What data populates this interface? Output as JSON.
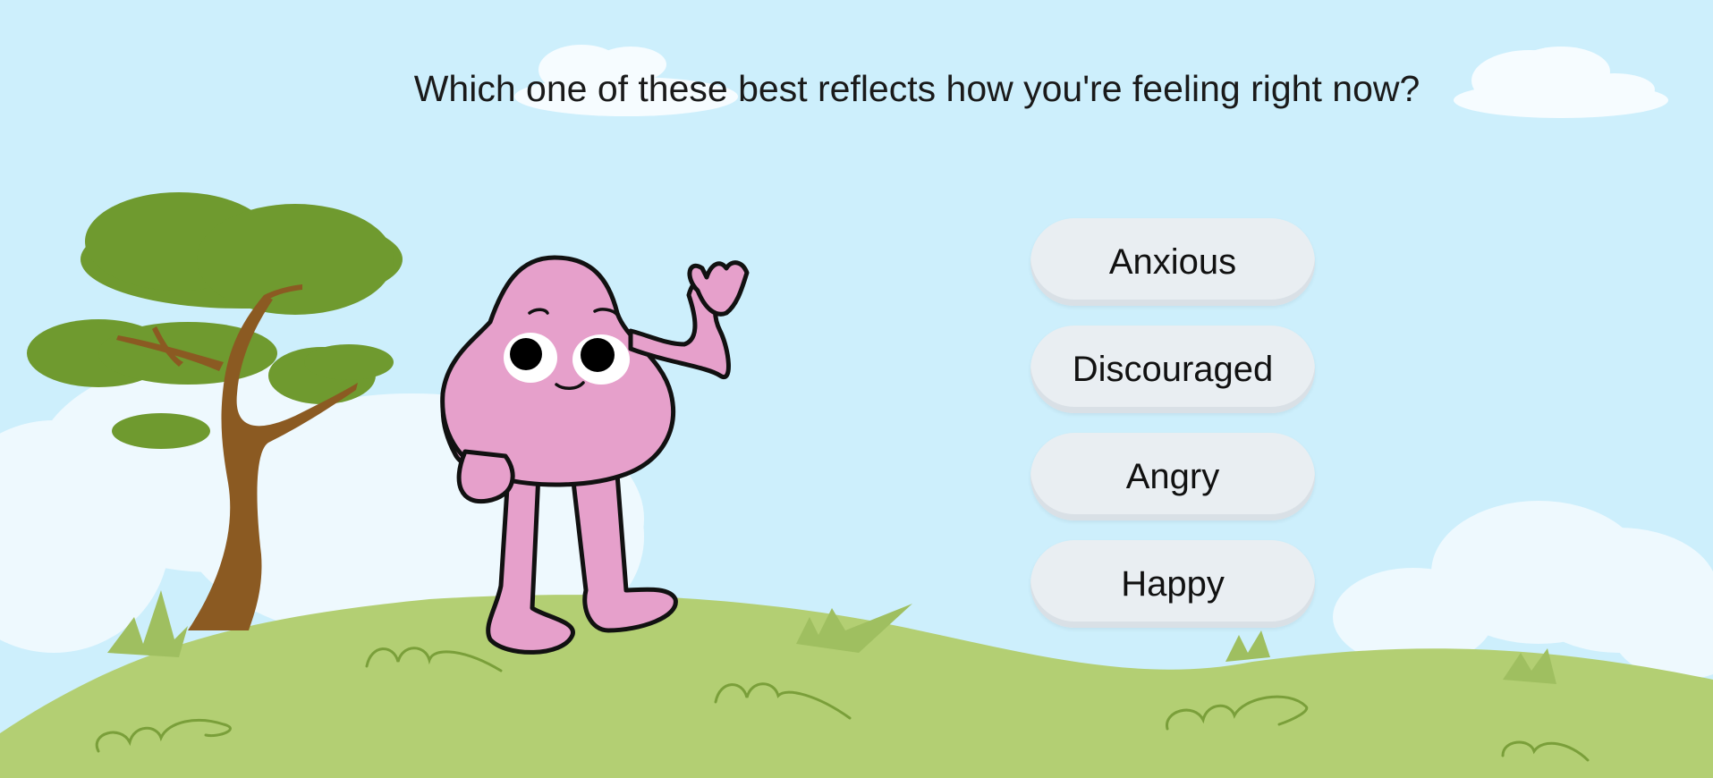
{
  "question": "Which one of these best reflects how you're feeling right now?",
  "options": [
    {
      "label": "Anxious"
    },
    {
      "label": "Discouraged"
    },
    {
      "label": "Angry"
    },
    {
      "label": "Happy"
    }
  ],
  "colors": {
    "sky": "#cdeffc",
    "cloud": "#ffffff",
    "grass": "#b3cf73",
    "tree_leaves": "#6f9a2f",
    "tree_trunk": "#8b5a22",
    "character": "#e6a0cb",
    "button": "#e9eef2"
  }
}
